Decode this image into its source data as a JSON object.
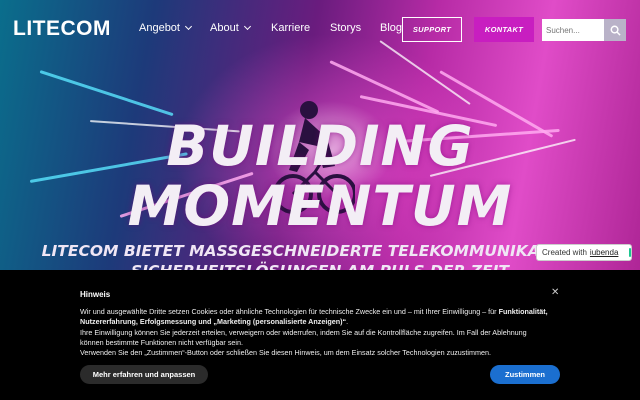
{
  "brand": {
    "logo_text": "Litecom"
  },
  "nav": {
    "items": [
      {
        "label": "Angebot",
        "has_dropdown": true
      },
      {
        "label": "About",
        "has_dropdown": true
      },
      {
        "label": "Karriere",
        "has_dropdown": false
      },
      {
        "label": "Storys",
        "has_dropdown": false
      },
      {
        "label": "Blog",
        "has_dropdown": false
      }
    ],
    "support_label": "SUPPORT",
    "kontakt_label": "KONTAKT",
    "search_placeholder": "Suchen...",
    "search_icon": "search-icon"
  },
  "hero": {
    "headline_line1": "BUILDING",
    "headline_line2": "MOMENTUM",
    "subline1": "LITECOM BIETET MASSGESCHNEIDERTE TELEKOMMUNIKATIONS-",
    "subline2": "SICHERHEITSLÖSUNGEN AM PULS DER ZEIT"
  },
  "iubenda_badge": {
    "prefix": "Created with",
    "link": "iubenda"
  },
  "cookie_banner": {
    "title": "Hinweis",
    "close_icon": "close-icon",
    "para1_start": "Wir und ausgewählte Dritte setzen Cookies oder ähnliche Technologien für technische Zwecke ein und – mit Ihrer Einwilligung – für ",
    "para1_bold": "Funktionalität, Nutzererfahrung, Erfolgsmessung und „Marketing (personalisierte Anzeigen)“",
    "para1_end": ".",
    "para2": "Ihre Einwilligung können Sie jederzeit erteilen, verweigern oder widerrufen, indem Sie auf die Kontrollfläche zugreifen. Im Fall der Ablehnung können bestimmte Funktionen nicht verfügbar sein.",
    "para3": "Verwenden Sie den „Zustimmen“-Button oder schließen Sie diesen Hinweis, um dem Einsatz solcher Technologien zuzustimmen.",
    "more_button": "Mehr erfahren und anpassen",
    "accept_button": "Zustimmen"
  },
  "colors": {
    "kontakt_bg": "#c81ec0",
    "accept_bg": "#1b6fd0",
    "banner_bg": "#000000",
    "iubenda_green": "#1cc691"
  }
}
